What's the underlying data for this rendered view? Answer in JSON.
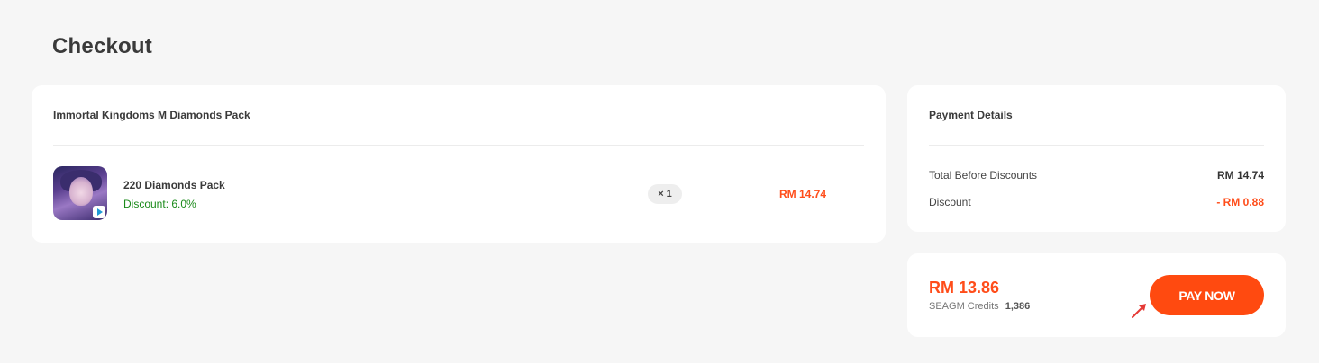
{
  "page": {
    "title": "Checkout"
  },
  "order": {
    "header": "Immortal Kingdoms M Diamonds Pack",
    "item": {
      "name": "220 Diamonds Pack",
      "discount": "Discount: 6.0%",
      "quantity": "× 1",
      "price": "RM 14.74",
      "thumbnail_icon": "game-thumbnail-icon"
    }
  },
  "payment_details": {
    "header": "Payment Details",
    "rows": [
      {
        "label": "Total Before Discounts",
        "value": "RM 14.74",
        "color": "#333333"
      },
      {
        "label": "Discount",
        "value": "- RM 0.88",
        "color": "#ff4d1a"
      }
    ]
  },
  "summary": {
    "total": "RM 13.86",
    "credits_label": "SEAGM Credits",
    "credits_value": "1,386",
    "pay_button": "PAY NOW",
    "accent_color": "#ff4a10"
  }
}
